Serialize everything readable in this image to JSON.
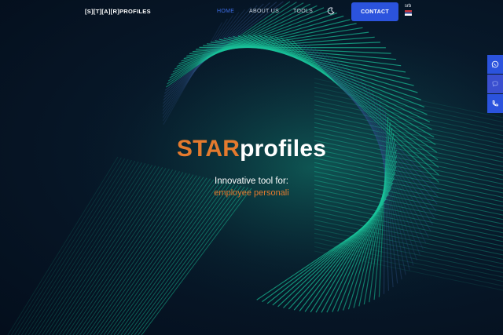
{
  "header": {
    "logo_text": "[S][T][A][R]PROFILES",
    "nav": [
      {
        "label": "HOME",
        "active": true
      },
      {
        "label": "ABOUT US",
        "active": false
      },
      {
        "label": "TOOLS",
        "active": false
      }
    ],
    "theme_toggle_icon": "moon-icon",
    "contact_label": "CONTACT",
    "language": {
      "code": "srb",
      "flag": "serbia-flag-icon"
    }
  },
  "side_contact": [
    {
      "icon": "whatsapp-icon"
    },
    {
      "icon": "viber-icon"
    },
    {
      "icon": "phone-icon"
    }
  ],
  "hero": {
    "title_accent": "STAR",
    "title_rest": "profiles",
    "subtitle": "Innovative tool for:",
    "typed_text": "employee personali"
  },
  "colors": {
    "accent_orange": "#e47a2e",
    "button_blue": "#2b53dd",
    "active_nav": "#3c6ee8",
    "background": "#061425",
    "wave_teal": "#19c39a"
  }
}
